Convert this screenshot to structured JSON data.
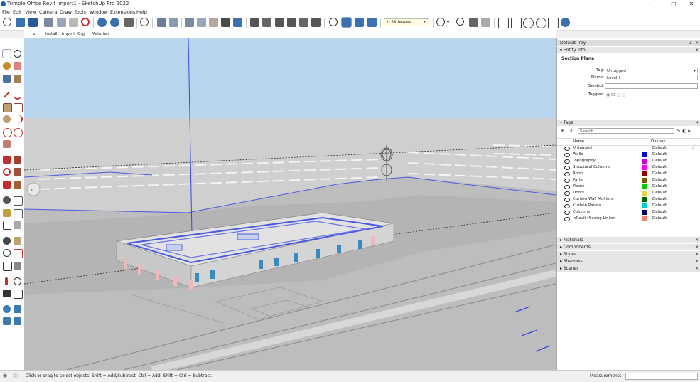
{
  "app": {
    "title": "Trimble Office Revit import1 - SketchUp Pro 2022"
  },
  "window_controls": {
    "minimize": "–",
    "maximize": "□",
    "close": "✕"
  },
  "menu": [
    "File",
    "Edit",
    "View",
    "Camera",
    "Draw",
    "Tools",
    "Window",
    "Extensions",
    "Help"
  ],
  "toolbar": {
    "tag_dropdown_value": "Untagged"
  },
  "tabs": [
    "Install",
    "Import",
    "Org",
    "Materials"
  ],
  "tray": {
    "title": "Default Tray",
    "entity_info": {
      "header": "Entity Info",
      "type": "Section Plane",
      "tag_label": "Tag:",
      "tag_value": "Untagged",
      "name_label": "Name:",
      "name_value": "Level 1",
      "symbol_label": "Symbol:",
      "symbol_value": "",
      "toggles_label": "Toggles:"
    },
    "tags": {
      "header": "Tags",
      "search_placeholder": "Search",
      "col_name": "Name",
      "col_dashes": "Dashes",
      "rows": [
        {
          "name": "Untagged",
          "color": "",
          "dashes": "Default"
        },
        {
          "name": "Walls",
          "color": "#0000cc",
          "dashes": "Default"
        },
        {
          "name": "Topography",
          "color": "#cc00cc",
          "dashes": "Default"
        },
        {
          "name": "Structural Columns",
          "color": "#ff00ff",
          "dashes": "Default"
        },
        {
          "name": "Roofs",
          "color": "#8b0000",
          "dashes": "Default"
        },
        {
          "name": "Parts",
          "color": "#7a5a00",
          "dashes": "Default"
        },
        {
          "name": "Floors",
          "color": "#00cc00",
          "dashes": "Default"
        },
        {
          "name": "Doors",
          "color": "#e6d24a",
          "dashes": "Default"
        },
        {
          "name": "Curtain Wall Mullions",
          "color": "#006600",
          "dashes": "Default"
        },
        {
          "name": "Curtain Panels",
          "color": "#00cccc",
          "dashes": "Default"
        },
        {
          "name": "Columns",
          "color": "#000066",
          "dashes": "Default"
        },
        {
          "name": "<Revit Missing Links>",
          "color": "#f08070",
          "dashes": "Default"
        }
      ]
    },
    "collapsed": [
      "Materials",
      "Components",
      "Styles",
      "Shadows",
      "Scenes"
    ]
  },
  "status": {
    "message": "Click or drag to select objects. Shift = Add/Subtract. Ctrl = Add. Shift + Ctrl = Subtract.",
    "measurements_label": "Measurements",
    "measurements_value": ""
  }
}
